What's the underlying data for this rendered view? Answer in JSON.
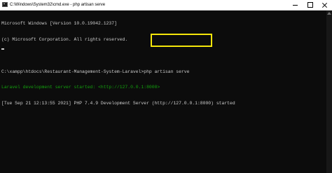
{
  "window": {
    "title": "C:\\Windows\\System32\\cmd.exe - php  artisan serve"
  },
  "console": {
    "lines": [
      "Microsoft Windows [Version 10.0.19042.1237]",
      "(c) Microsoft Corporation. All rights reserved.",
      "",
      "C:\\xampp\\htdocs\\Restaurant-Management-System-Laravel>php artisan serve"
    ],
    "server_started_prefix": "Laravel development server started: ",
    "server_started_url": "<http://127.0.0.1:8000>",
    "log_prefix": "[Tue Sep 21 12:13:55 2021] PHP 7.4.9 Development Server ",
    "log_url": "(http://127.0.0.1:8000)",
    "log_suffix": " started"
  },
  "colors": {
    "terminal_background": "#0c0c0c",
    "terminal_text": "#cccccc",
    "server_message": "#13a10e",
    "highlight_box": "#f5e60a"
  },
  "icons": {
    "app": "cmd-icon",
    "minimize": "minimize-icon",
    "maximize": "maximize-icon",
    "close": "close-icon"
  }
}
